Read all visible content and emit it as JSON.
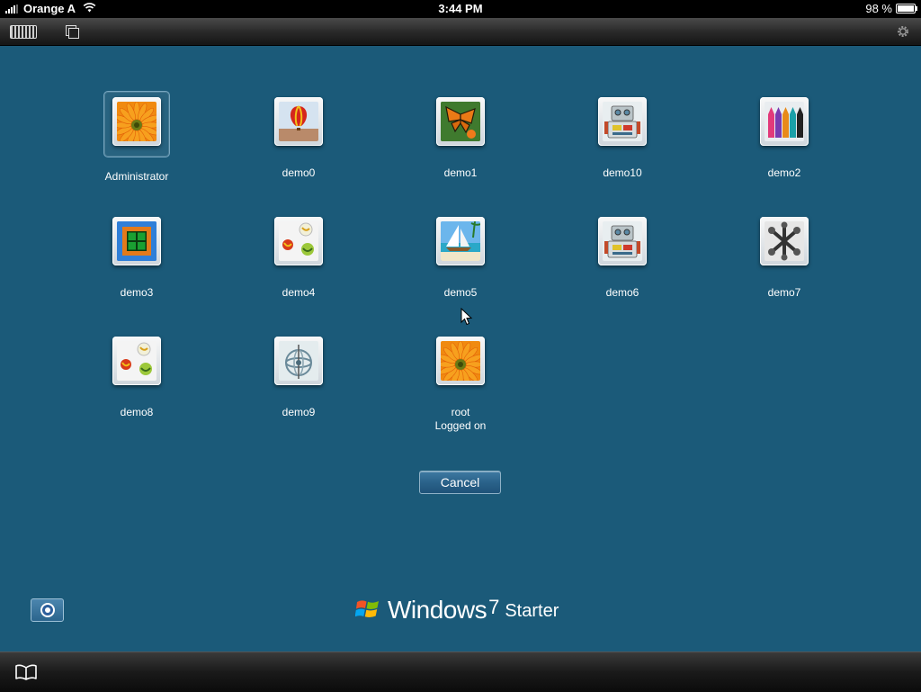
{
  "status_bar": {
    "carrier": "Orange A",
    "time": "3:44 PM",
    "battery_text": "98 %",
    "battery_level": 0.98,
    "signal_icon": "signal-bars-icon",
    "wifi_icon": "wifi-icon"
  },
  "toolbar": {
    "keyboard_icon": "keyboard-icon",
    "windows_icon": "windows-switch-icon",
    "settings_icon": "gear-icon"
  },
  "users": [
    {
      "name": "Administrator",
      "status": "",
      "picture": "flower-orange",
      "selected": true
    },
    {
      "name": "demo0",
      "status": "",
      "picture": "hot-air-balloon"
    },
    {
      "name": "demo1",
      "status": "",
      "picture": "butterfly"
    },
    {
      "name": "demo10",
      "status": "",
      "picture": "robot"
    },
    {
      "name": "demo2",
      "status": "",
      "picture": "crayons"
    },
    {
      "name": "demo3",
      "status": "",
      "picture": "window-frame"
    },
    {
      "name": "demo4",
      "status": "",
      "picture": "marbles"
    },
    {
      "name": "demo5",
      "status": "",
      "picture": "sailboat"
    },
    {
      "name": "demo6",
      "status": "",
      "picture": "robot"
    },
    {
      "name": "demo7",
      "status": "",
      "picture": "jacks"
    },
    {
      "name": "demo8",
      "status": "",
      "picture": "marbles"
    },
    {
      "name": "demo9",
      "status": "",
      "picture": "gyroscope"
    },
    {
      "name": "root",
      "status": "Logged on",
      "picture": "flower-orange"
    }
  ],
  "cancel_label": "Cancel",
  "ease_of_access_icon": "ease-of-access-icon",
  "brand": {
    "main": "Windows",
    "version": "7",
    "edition": "Starter"
  },
  "bottom_bar": {
    "bookmark_icon": "open-book-icon"
  },
  "colors": {
    "background": "#1b5a79",
    "button_blue": "#2a628a"
  }
}
